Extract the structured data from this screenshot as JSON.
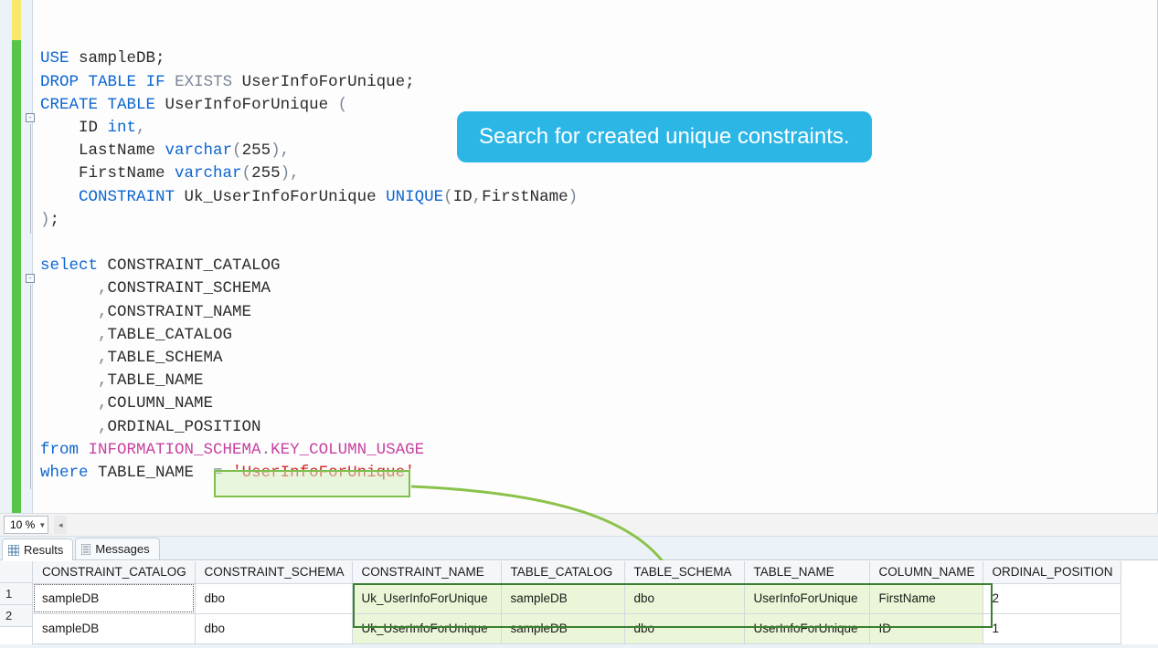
{
  "callout": "Search for created unique constraints.",
  "zoom": "10 %",
  "tabs": {
    "results": "Results",
    "messages": "Messages"
  },
  "sql_tokens": [
    [],
    [],
    [
      {
        "t": "USE",
        "c": "kw"
      },
      {
        "t": " sampleDB;",
        "c": ""
      }
    ],
    [
      {
        "t": "DROP",
        "c": "kw"
      },
      {
        "t": " ",
        "c": ""
      },
      {
        "t": "TABLE",
        "c": "kw"
      },
      {
        "t": " ",
        "c": ""
      },
      {
        "t": "IF",
        "c": "kw"
      },
      {
        "t": " ",
        "c": ""
      },
      {
        "t": "EXISTS",
        "c": "gray"
      },
      {
        "t": " UserInfoForUnique;",
        "c": ""
      }
    ],
    [
      {
        "t": "CREATE",
        "c": "kw"
      },
      {
        "t": " ",
        "c": ""
      },
      {
        "t": "TABLE",
        "c": "kw"
      },
      {
        "t": " UserInfoForUnique ",
        "c": ""
      },
      {
        "t": "(",
        "c": "gray"
      }
    ],
    [
      {
        "t": "    ID ",
        "c": ""
      },
      {
        "t": "int",
        "c": "type"
      },
      {
        "t": ",",
        "c": "gray"
      }
    ],
    [
      {
        "t": "    LastName ",
        "c": ""
      },
      {
        "t": "varchar",
        "c": "type"
      },
      {
        "t": "(",
        "c": "gray"
      },
      {
        "t": "255",
        "c": ""
      },
      {
        "t": "),",
        "c": "gray"
      }
    ],
    [
      {
        "t": "    FirstName ",
        "c": ""
      },
      {
        "t": "varchar",
        "c": "type"
      },
      {
        "t": "(",
        "c": "gray"
      },
      {
        "t": "255",
        "c": ""
      },
      {
        "t": "),",
        "c": "gray"
      }
    ],
    [
      {
        "t": "    ",
        "c": ""
      },
      {
        "t": "CONSTRAINT",
        "c": "kw"
      },
      {
        "t": " Uk_UserInfoForUnique ",
        "c": ""
      },
      {
        "t": "UNIQUE",
        "c": "kw"
      },
      {
        "t": "(",
        "c": "gray"
      },
      {
        "t": "ID",
        "c": ""
      },
      {
        "t": ",",
        "c": "gray"
      },
      {
        "t": "FirstName",
        "c": ""
      },
      {
        "t": ")",
        "c": "gray"
      }
    ],
    [
      {
        "t": ")",
        "c": "gray"
      },
      {
        "t": ";",
        "c": ""
      }
    ],
    [],
    [
      {
        "t": "select",
        "c": "kw"
      },
      {
        "t": " CONSTRAINT_CATALOG",
        "c": ""
      }
    ],
    [
      {
        "t": "      ",
        "c": ""
      },
      {
        "t": ",",
        "c": "gray"
      },
      {
        "t": "CONSTRAINT_SCHEMA",
        "c": ""
      }
    ],
    [
      {
        "t": "      ",
        "c": ""
      },
      {
        "t": ",",
        "c": "gray"
      },
      {
        "t": "CONSTRAINT_NAME",
        "c": ""
      }
    ],
    [
      {
        "t": "      ",
        "c": ""
      },
      {
        "t": ",",
        "c": "gray"
      },
      {
        "t": "TABLE_CATALOG",
        "c": ""
      }
    ],
    [
      {
        "t": "      ",
        "c": ""
      },
      {
        "t": ",",
        "c": "gray"
      },
      {
        "t": "TABLE_SCHEMA",
        "c": ""
      }
    ],
    [
      {
        "t": "      ",
        "c": ""
      },
      {
        "t": ",",
        "c": "gray"
      },
      {
        "t": "TABLE_NAME",
        "c": ""
      }
    ],
    [
      {
        "t": "      ",
        "c": ""
      },
      {
        "t": ",",
        "c": "gray"
      },
      {
        "t": "COLUMN_NAME",
        "c": ""
      }
    ],
    [
      {
        "t": "      ",
        "c": ""
      },
      {
        "t": ",",
        "c": "gray"
      },
      {
        "t": "ORDINAL_POSITION",
        "c": ""
      }
    ],
    [
      {
        "t": "from",
        "c": "kw"
      },
      {
        "t": " ",
        "c": ""
      },
      {
        "t": "INFORMATION_SCHEMA",
        "c": "func"
      },
      {
        "t": ".",
        "c": "gray"
      },
      {
        "t": "KEY_COLUMN_USAGE",
        "c": "func"
      }
    ],
    [
      {
        "t": "where",
        "c": "kw"
      },
      {
        "t": " TABLE_NAME  ",
        "c": ""
      },
      {
        "t": "=",
        "c": "gray"
      },
      {
        "t": " ",
        "c": ""
      },
      {
        "t": "'UserInfoForUnique'",
        "c": "str"
      }
    ]
  ],
  "grid": {
    "headers": [
      "CONSTRAINT_CATALOG",
      "CONSTRAINT_SCHEMA",
      "CONSTRAINT_NAME",
      "TABLE_CATALOG",
      "TABLE_SCHEMA",
      "TABLE_NAME",
      "COLUMN_NAME",
      "ORDINAL_POSITION"
    ],
    "rows": [
      [
        "sampleDB",
        "dbo",
        "Uk_UserInfoForUnique",
        "sampleDB",
        "dbo",
        "UserInfoForUnique",
        "FirstName",
        "2"
      ],
      [
        "sampleDB",
        "dbo",
        "Uk_UserInfoForUnique",
        "sampleDB",
        "dbo",
        "UserInfoForUnique",
        "ID",
        "1"
      ]
    ],
    "rownums": [
      "1",
      "2"
    ]
  }
}
